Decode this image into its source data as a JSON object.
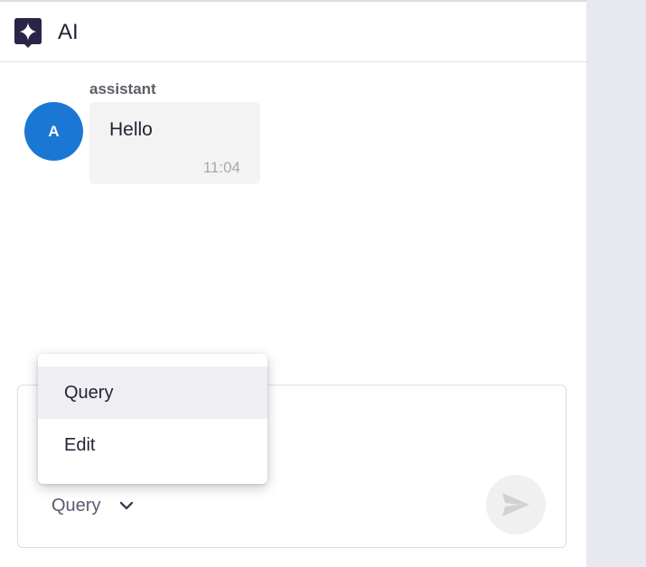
{
  "header": {
    "title": "AI",
    "logo_icon": "sparkle-logo-icon",
    "logo_color": "#2a2547"
  },
  "messages": [
    {
      "sender": "assistant",
      "avatar_initial": "A",
      "avatar_color": "#1a78d4",
      "text": "Hello",
      "time": "11:04"
    }
  ],
  "composer": {
    "mode_selected": "Query",
    "mode_options": [
      "Query",
      "Edit"
    ],
    "send_icon": "send-icon"
  },
  "dropdown": {
    "items": [
      {
        "label": "Query",
        "active": true
      },
      {
        "label": "Edit",
        "active": false
      }
    ]
  }
}
